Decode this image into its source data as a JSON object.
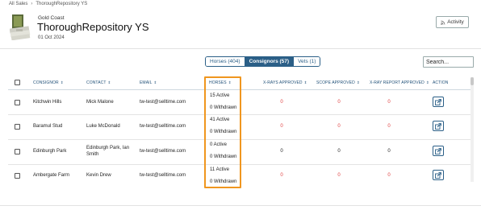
{
  "breadcrumb": {
    "items": [
      "All Sales",
      "ThoroughRepository YS"
    ]
  },
  "sale": {
    "region": "Gold Coast",
    "title": "ThoroughRepository YS",
    "date": "01 Oct 2024"
  },
  "activity_button": {
    "label": "Activity",
    "icon": "rss-icon"
  },
  "tabs": [
    {
      "label": "Horses (404)",
      "active": false
    },
    {
      "label": "Consignors (57)",
      "active": true
    },
    {
      "label": "Vets (1)",
      "active": false
    }
  ],
  "search": {
    "placeholder": "Search..."
  },
  "table": {
    "headers": {
      "consignor": "CONSIGNOR",
      "contact": "CONTACT",
      "email": "EMAIL",
      "horses": "HORSES",
      "xrays": "X-RAYS APPROVED",
      "scope": "SCOPE APPROVED",
      "xray_report": "X-RAY REPORT APPROVED",
      "action": "ACTION"
    },
    "rows": [
      {
        "consignor": "Kitchwin Hills",
        "contact": "Mick Malone",
        "email": "tw-test@selltime.com",
        "active": "15 Active",
        "withdrawn": "0 Withdrawn",
        "xrays": "0",
        "scope": "0",
        "xray_report": "0",
        "status": "red"
      },
      {
        "consignor": "Baramul Stud",
        "contact": "Luke McDonald",
        "email": "tw-test@selltime.com",
        "active": "41 Active",
        "withdrawn": "0 Withdrawn",
        "xrays": "0",
        "scope": "0",
        "xray_report": "0",
        "status": "red"
      },
      {
        "consignor": "Edinburgh Park",
        "contact": "Edinburgh Park, Ian Smith",
        "email": "tw-test@selltime.com",
        "active": "0 Active",
        "withdrawn": "0 Withdrawn",
        "xrays": "0",
        "scope": "0",
        "xray_report": "0",
        "status": "black"
      },
      {
        "consignor": "Ambergate Farm",
        "contact": "Kevin Drew",
        "email": "tw-test@selltime.com",
        "active": "11 Active",
        "withdrawn": "0 Withdrawn",
        "xrays": "0",
        "scope": "0",
        "xray_report": "0",
        "status": "red"
      }
    ]
  },
  "colors": {
    "accent": "#2b5f87",
    "highlight": "#f0961f",
    "zero_red": "#e04040"
  }
}
